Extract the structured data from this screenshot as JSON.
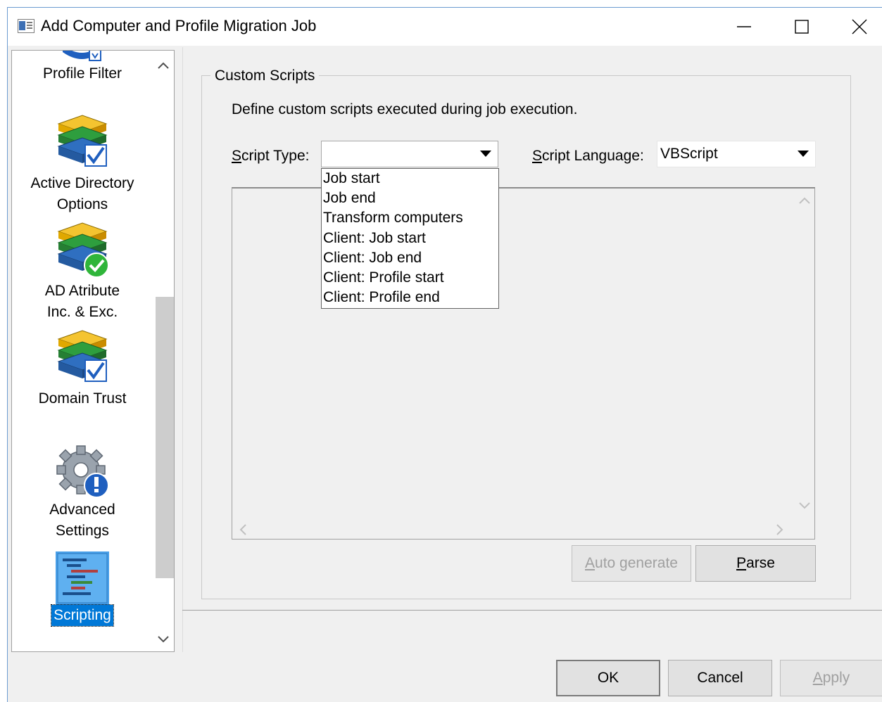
{
  "window": {
    "title": "Add Computer and Profile Migration Job"
  },
  "sidebar": {
    "items": [
      {
        "label": "Profile Filter",
        "icon": "profile-filter-icon",
        "selected": false
      },
      {
        "label": "Active Directory Options",
        "line1": "Active Directory",
        "line2": "Options",
        "icon": "books-check-icon",
        "selected": false
      },
      {
        "label": "AD Atribute Inc. & Exc.",
        "line1": "AD Atribute",
        "line2": "Inc. & Exc.",
        "icon": "books-green-check-icon",
        "selected": false
      },
      {
        "label": "Domain Trust",
        "icon": "books-check-icon",
        "selected": false
      },
      {
        "label": "Advanced Settings",
        "line1": "Advanced",
        "line2": "Settings",
        "icon": "gear-info-icon",
        "selected": false
      },
      {
        "label": "Scripting",
        "icon": "script-icon",
        "selected": true
      }
    ]
  },
  "custom_scripts": {
    "group_title": "Custom Scripts",
    "description": "Define custom scripts executed during job execution.",
    "script_type_label": "Script Type:",
    "script_type_label_underline": "S",
    "script_type_label_rest": "cript Type:",
    "script_type_value": "",
    "script_type_options": [
      "Job start",
      "Job end",
      "Transform computers",
      "Client: Job start",
      "Client: Job end",
      "Client: Profile start",
      "Client: Profile end"
    ],
    "script_language_label": "Script Language:",
    "script_language_label_underline": "S",
    "script_language_label_rest": "cript Language:",
    "script_language_value": "VBScript",
    "auto_generate_label": "Auto generate",
    "auto_generate_underline": "A",
    "auto_generate_rest": "uto generate",
    "parse_label": "Parse",
    "parse_underline": "P",
    "parse_rest": "arse"
  },
  "footer": {
    "ok_label": "OK",
    "cancel_label": "Cancel",
    "apply_label": "Apply",
    "apply_underline": "A",
    "apply_rest": "pply"
  }
}
